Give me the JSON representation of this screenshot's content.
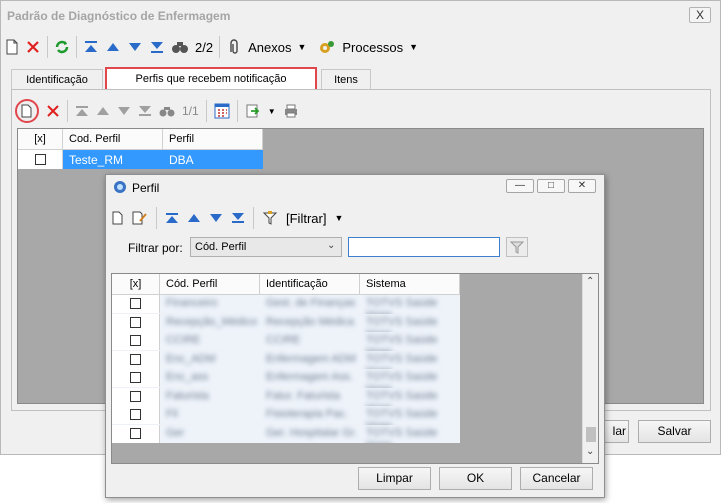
{
  "main": {
    "title": "Padrão de Diagnóstico de Enfermagem",
    "close_label": "X",
    "toolbar": {
      "record_counter": "2/2",
      "anexos_label": "Anexos",
      "processos_label": "Processos"
    },
    "tabs": [
      {
        "label": "Identificação"
      },
      {
        "label": "Perfis que recebem notificação"
      },
      {
        "label": "Itens"
      }
    ],
    "subtoolbar": {
      "record_counter": "1/1"
    },
    "grid": {
      "headers": [
        "[x]",
        "Cod. Perfil",
        "Perfil"
      ],
      "rows": [
        {
          "cod": "Teste_RM",
          "perfil": "DBA"
        }
      ]
    },
    "buttons": {
      "salvar_partial": "lar",
      "salvar": "Salvar"
    }
  },
  "dialog": {
    "title": "Perfil",
    "toolbar": {
      "filter_label": "[Filtrar]"
    },
    "filter": {
      "label": "Filtrar por:",
      "selected": "Cód. Perfil",
      "value": ""
    },
    "grid": {
      "headers": [
        "[x]",
        "Cód. Perfil",
        "Identificação",
        "Sistema"
      ],
      "rows": [
        {
          "c1": "Financeiro",
          "c2": "Gest. de Finanças",
          "c3": "TOTVS Saúde Hosp."
        },
        {
          "c1": "Recepção_Médico",
          "c2": "Recepção Médica",
          "c3": "TOTVS Saúde Hosp."
        },
        {
          "c1": "CCIRE",
          "c2": "CCIRE",
          "c3": "TOTVS Saúde Hosp."
        },
        {
          "c1": "Enc_ADM",
          "c2": "Enfermagem ADM",
          "c3": "TOTVS Saúde Hosp."
        },
        {
          "c1": "Enc_ass",
          "c2": "Enfermagem Ass.",
          "c3": "TOTVS Saúde Hosp."
        },
        {
          "c1": "Faturista",
          "c2": "Fatur. Faturista",
          "c3": "TOTVS Saúde Hosp."
        },
        {
          "c1": "Fil",
          "c2": "Fisioterapia Pac.",
          "c3": "TOTVS Saúde Hosp."
        },
        {
          "c1": "Ger",
          "c2": "Ger. Hospitalar Gr.",
          "c3": "TOTVS Saúde Hosp."
        }
      ]
    },
    "buttons": {
      "limpar": "Limpar",
      "ok": "OK",
      "cancelar": "Cancelar"
    }
  },
  "colors": {
    "selection": "#3399ff",
    "highlight_box": "#e0474c",
    "grid_bg": "#a8a8a8"
  }
}
